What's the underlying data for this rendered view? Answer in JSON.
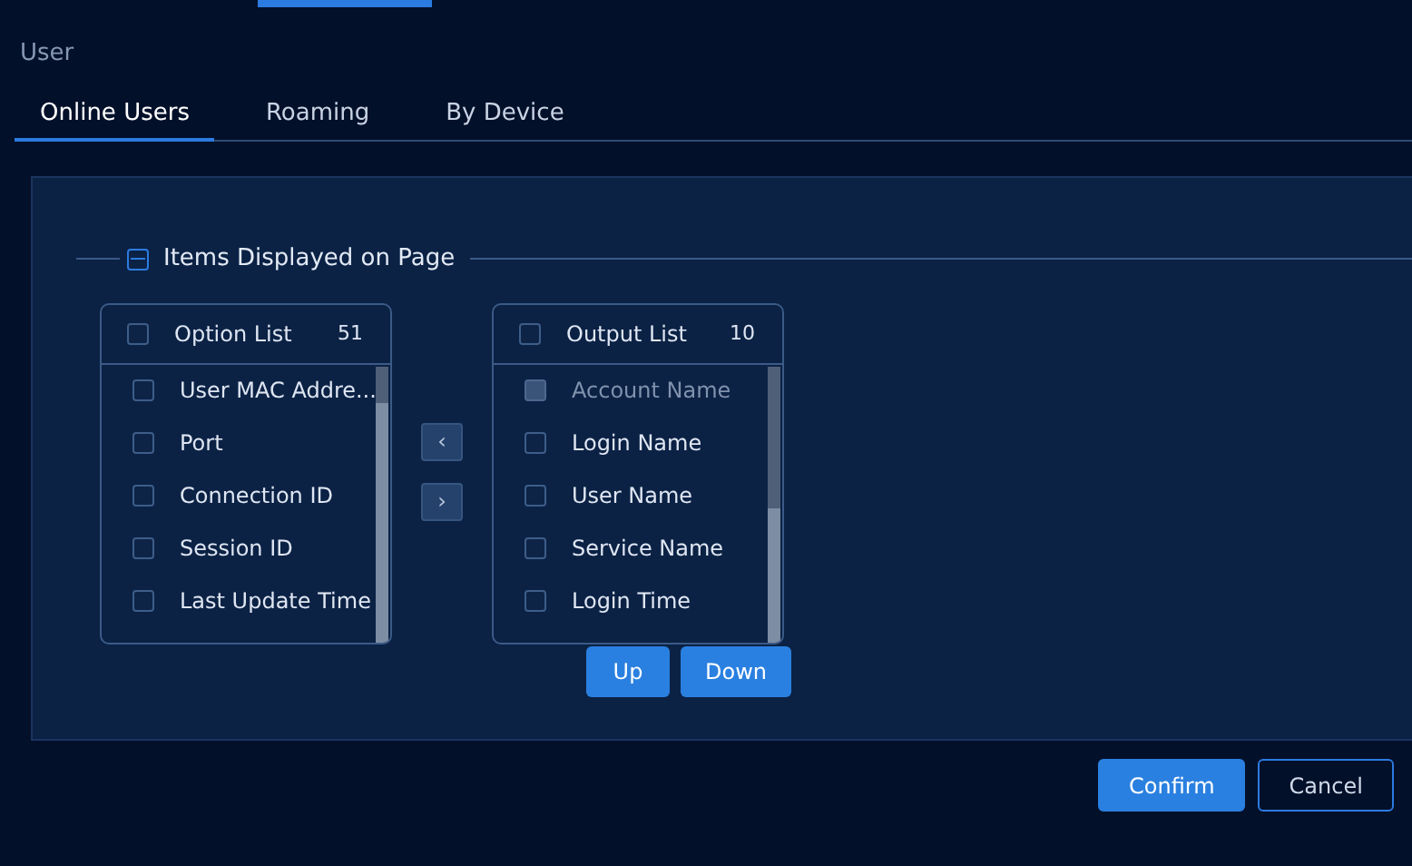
{
  "page_title": "User",
  "tabs": [
    {
      "label": "Online Users",
      "selected": true
    },
    {
      "label": "Roaming",
      "selected": false
    },
    {
      "label": "By Device",
      "selected": false
    }
  ],
  "section": {
    "title": "Items Displayed on Page",
    "indeterminate": true
  },
  "option_list": {
    "title": "Option List",
    "count": "51",
    "checked": false,
    "items": [
      {
        "label": "User MAC Addre...",
        "checked": false,
        "disabled": false
      },
      {
        "label": "Port",
        "checked": false,
        "disabled": false
      },
      {
        "label": "Connection ID",
        "checked": false,
        "disabled": false
      },
      {
        "label": "Session ID",
        "checked": false,
        "disabled": false
      },
      {
        "label": "Last Update Time",
        "checked": false,
        "disabled": false
      }
    ]
  },
  "transfer_buttons": [
    "‹",
    "›"
  ],
  "output_list": {
    "title": "Output List",
    "count": "10",
    "checked": false,
    "items": [
      {
        "label": "Account Name",
        "checked": false,
        "disabled": true
      },
      {
        "label": "Login Name",
        "checked": false,
        "disabled": false
      },
      {
        "label": "User Name",
        "checked": false,
        "disabled": false
      },
      {
        "label": "Service Name",
        "checked": false,
        "disabled": false
      },
      {
        "label": "Login Time",
        "checked": false,
        "disabled": false
      }
    ]
  },
  "order_buttons": [
    "Up",
    "Down"
  ],
  "footer_buttons": [
    {
      "label": "Confirm",
      "kind": "primary"
    },
    {
      "label": "Cancel",
      "kind": "outline"
    }
  ]
}
